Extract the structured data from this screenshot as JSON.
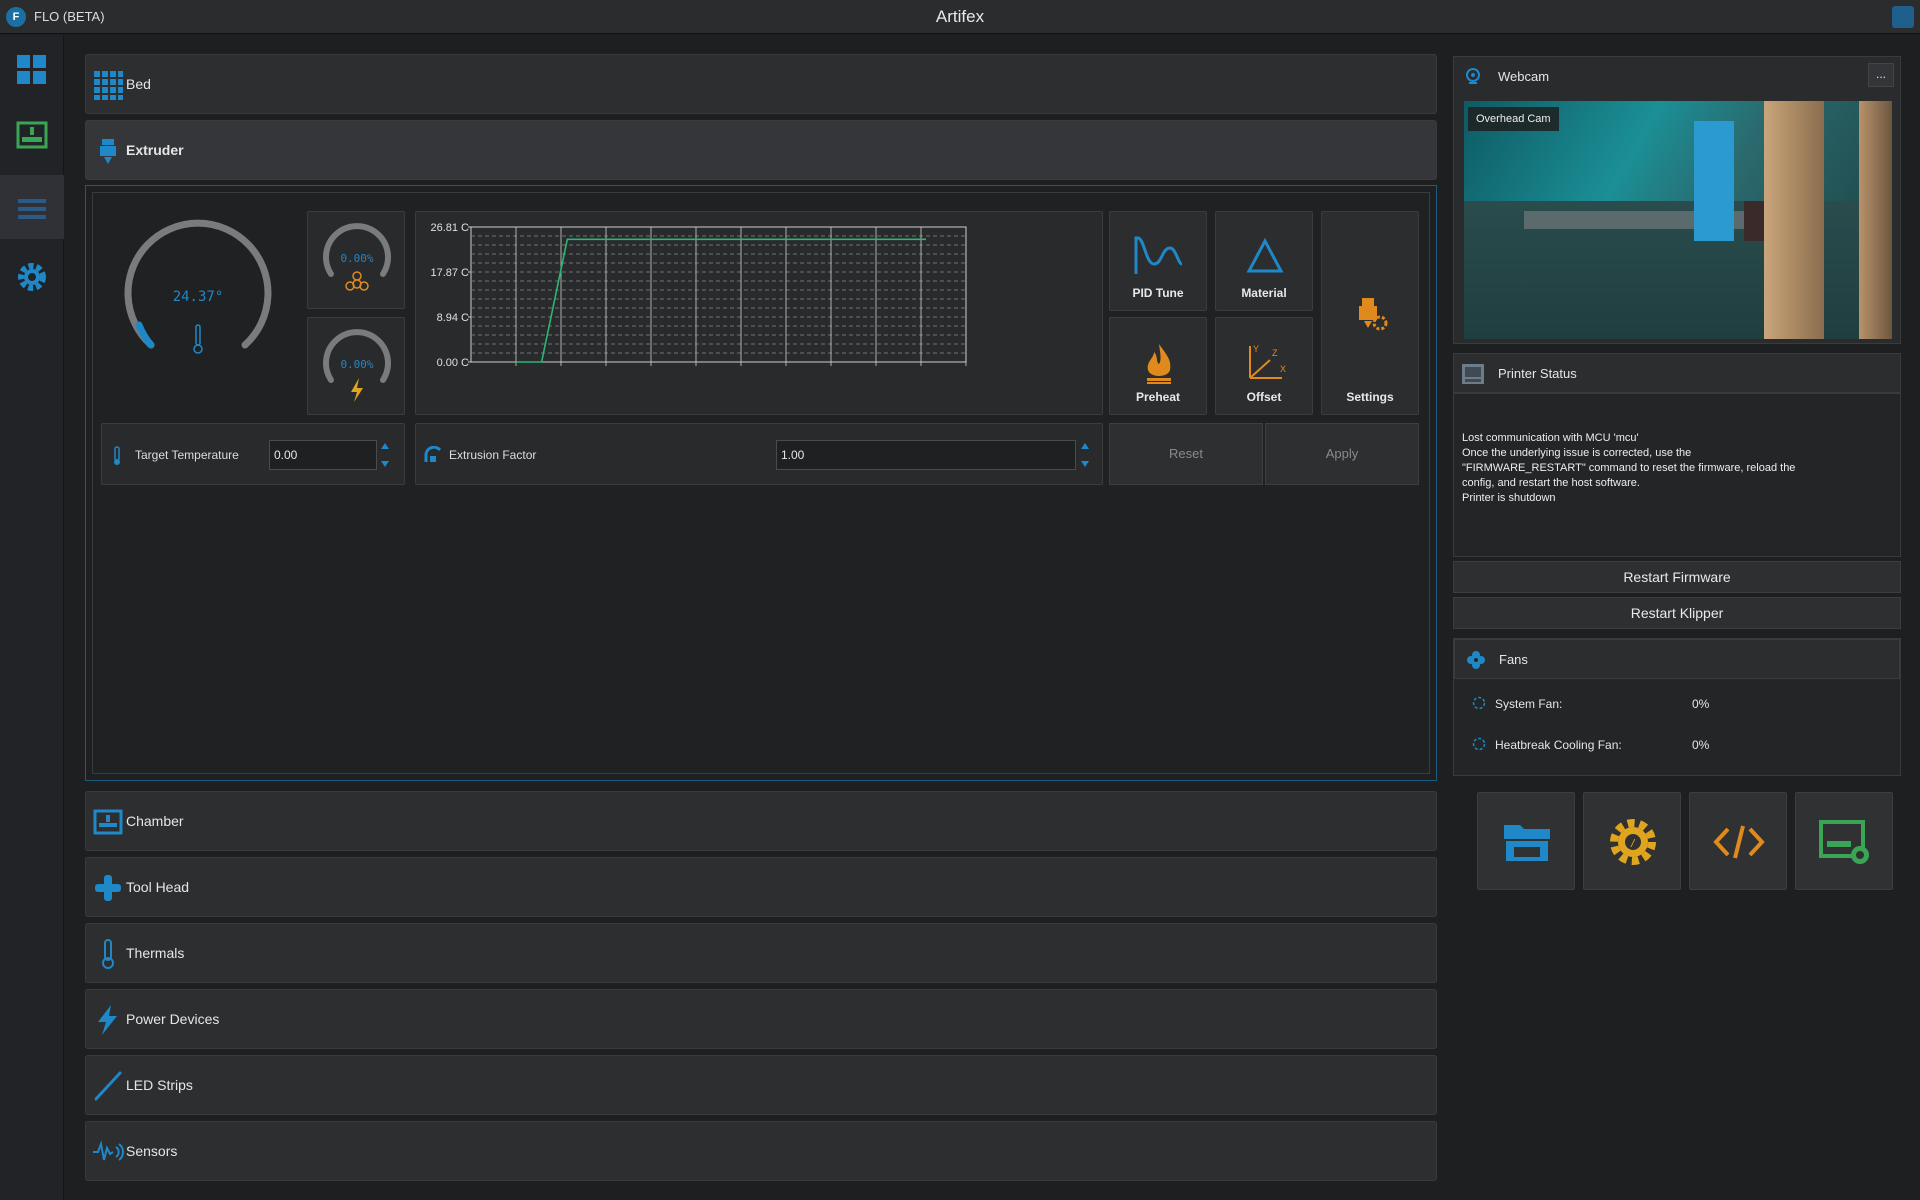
{
  "titlebar": {
    "app_name": "FLO (BETA)",
    "title": "Artifex"
  },
  "sections": {
    "bed": "Bed",
    "extruder": "Extruder",
    "chamber": "Chamber",
    "tool_head": "Tool Head",
    "thermals": "Thermals",
    "power_devices": "Power Devices",
    "led_strips": "LED Strips",
    "sensors": "Sensors"
  },
  "extruder": {
    "temperature_gauge": "24.37°",
    "fan_gauge": "0.00%",
    "power_gauge": "0.00%",
    "target_temperature_label": "Target Temperature",
    "target_temperature_value": "0.00",
    "extrusion_factor_label": "Extrusion Factor",
    "extrusion_factor_value": "1.00",
    "reset_label": "Reset",
    "apply_label": "Apply",
    "tiles": {
      "pid_tune": "PID Tune",
      "material": "Material",
      "preheat": "Preheat",
      "offset": "Offset",
      "settings": "Settings"
    },
    "axis_letters": {
      "y": "Y",
      "z": "Z",
      "x": "X"
    }
  },
  "chart_data": {
    "type": "line",
    "title": "",
    "xlabel": "",
    "ylabel": "",
    "ylim": [
      0,
      26.81
    ],
    "y_ticks": [
      "26.81 C",
      "17.87 C",
      "8.94 C",
      "0.00 C"
    ],
    "series": [
      {
        "x": [
          0,
          1,
          2,
          3,
          4,
          5,
          6,
          7,
          8,
          9,
          10,
          11,
          12,
          13,
          14,
          15,
          16
        ],
        "values": [
          0,
          0,
          24.37,
          24.37,
          24.37,
          24.37,
          24.37,
          24.37,
          24.37,
          24.37,
          24.37,
          24.37,
          24.37,
          24.37,
          24.37,
          24.37,
          24.37
        ]
      }
    ],
    "line_color": "#2bb673",
    "grid": true
  },
  "webcam": {
    "title": "Webcam",
    "menu_label": "...",
    "camera_name": "Overhead Cam"
  },
  "printer_status": {
    "title": "Printer Status",
    "lines": [
      "Lost communication with MCU 'mcu'",
      "Once the underlying issue is corrected, use the",
      "\"FIRMWARE_RESTART\" command to reset the firmware, reload the",
      "config, and restart the host software.",
      "Printer is shutdown"
    ],
    "restart_firmware": "Restart Firmware",
    "restart_klipper": "Restart Klipper"
  },
  "fans": {
    "title": "Fans",
    "items": [
      {
        "label": "System Fan:",
        "value": "0%"
      },
      {
        "label": "Heatbreak Cooling Fan:",
        "value": "0%"
      }
    ]
  },
  "colors": {
    "accent_blue": "#1e88c8",
    "orange": "#e08a1e",
    "green": "#3aa655"
  }
}
